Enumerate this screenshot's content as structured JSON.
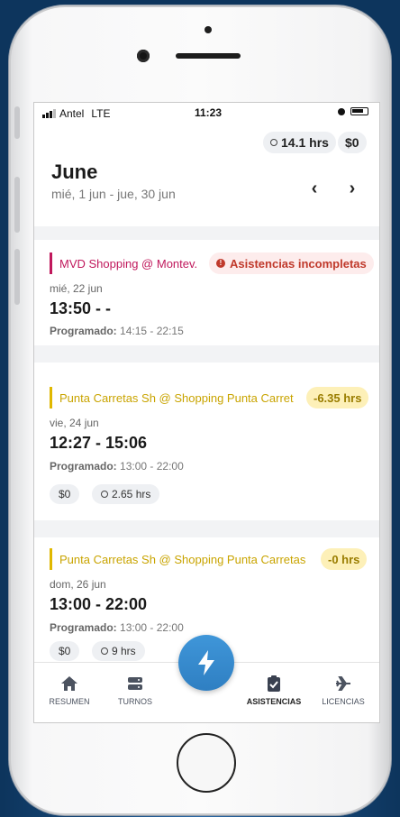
{
  "status_bar": {
    "carrier": "Antel",
    "network": "LTE",
    "time": "11:23"
  },
  "header": {
    "hours_total": "14.1 hrs",
    "money_total": "$0",
    "month": "June",
    "date_range": "mié, 1 jun - jue, 30 jun"
  },
  "shifts": [
    {
      "location": "MVD Shopping @ Montev.",
      "status": "Asistencias incompletas",
      "date": "mié, 22 jun",
      "time": "13:50 - -",
      "scheduled_label": "Programado:",
      "scheduled": "14:15 - 22:15"
    },
    {
      "location": "Punta Carretas Sh @ Shopping Punta Carret",
      "hours_diff": "-6.35 hrs",
      "date": "vie, 24 jun",
      "time": "12:27 - 15:06",
      "scheduled_label": "Programado:",
      "scheduled": "13:00 - 22:00",
      "money": "$0",
      "hours": "2.65 hrs"
    },
    {
      "location": "Punta Carretas Sh @ Shopping Punta Carretas",
      "hours_diff": "-0 hrs",
      "date": "dom, 26 jun",
      "time": "13:00 - 22:00",
      "scheduled_label": "Programado:",
      "scheduled": "13:00 - 22:00",
      "money": "$0",
      "hours": "9 hrs"
    }
  ],
  "tabs": [
    {
      "label": "RESUMEN",
      "icon": "home-icon"
    },
    {
      "label": "TURNOS",
      "icon": "server-icon"
    },
    {
      "label": "ASISTENCIAS",
      "icon": "clipboard-check-icon",
      "active": true
    },
    {
      "label": "LICENCIAS",
      "icon": "airplane-icon"
    }
  ],
  "colors": {
    "accent": "#3a8fd4",
    "alert_red": "#c0392b",
    "alert_bg": "#fdecec",
    "warn_yellow": "#d4b000",
    "warn_bg": "#fdf3c4",
    "pink_bar": "#c0185c"
  }
}
